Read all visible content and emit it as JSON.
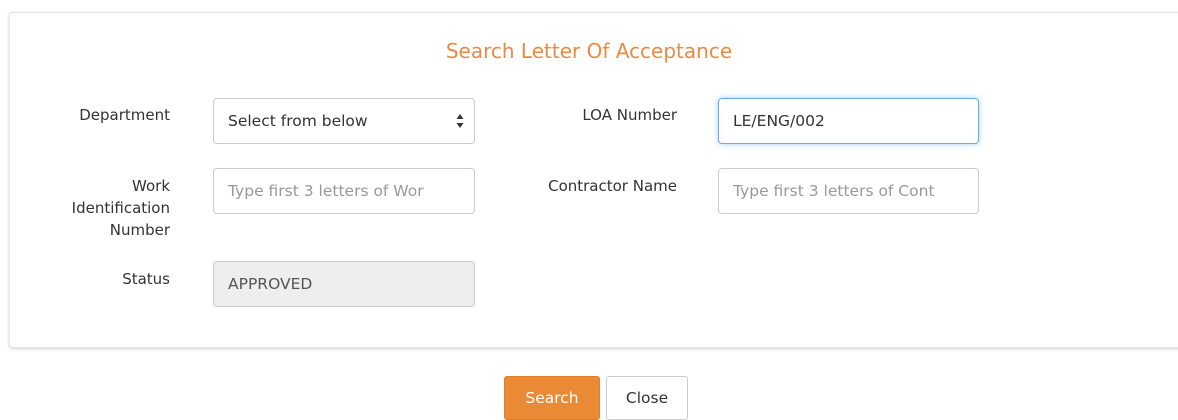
{
  "form": {
    "title": "Search Letter Of Acceptance",
    "department": {
      "label": "Department",
      "selected": "Select from below"
    },
    "loa_number": {
      "label": "LOA Number",
      "value": "LE/ENG/002"
    },
    "work_id": {
      "label_line1": "Work",
      "label_line2": "Identification",
      "label_line3": "Number",
      "placeholder": "Type first 3 letters of Wor"
    },
    "contractor": {
      "label": "Contractor Name",
      "placeholder": "Type first 3 letters of Cont"
    },
    "status": {
      "label": "Status",
      "value": "APPROVED"
    }
  },
  "buttons": {
    "search_label": "Search",
    "close_label": "Close"
  },
  "colors": {
    "accent": "#ea8a45",
    "primary_button": "#ea8a34",
    "focus_border": "#66afe9"
  },
  "icons": {
    "select_arrows": "up-down-arrows-icon"
  }
}
